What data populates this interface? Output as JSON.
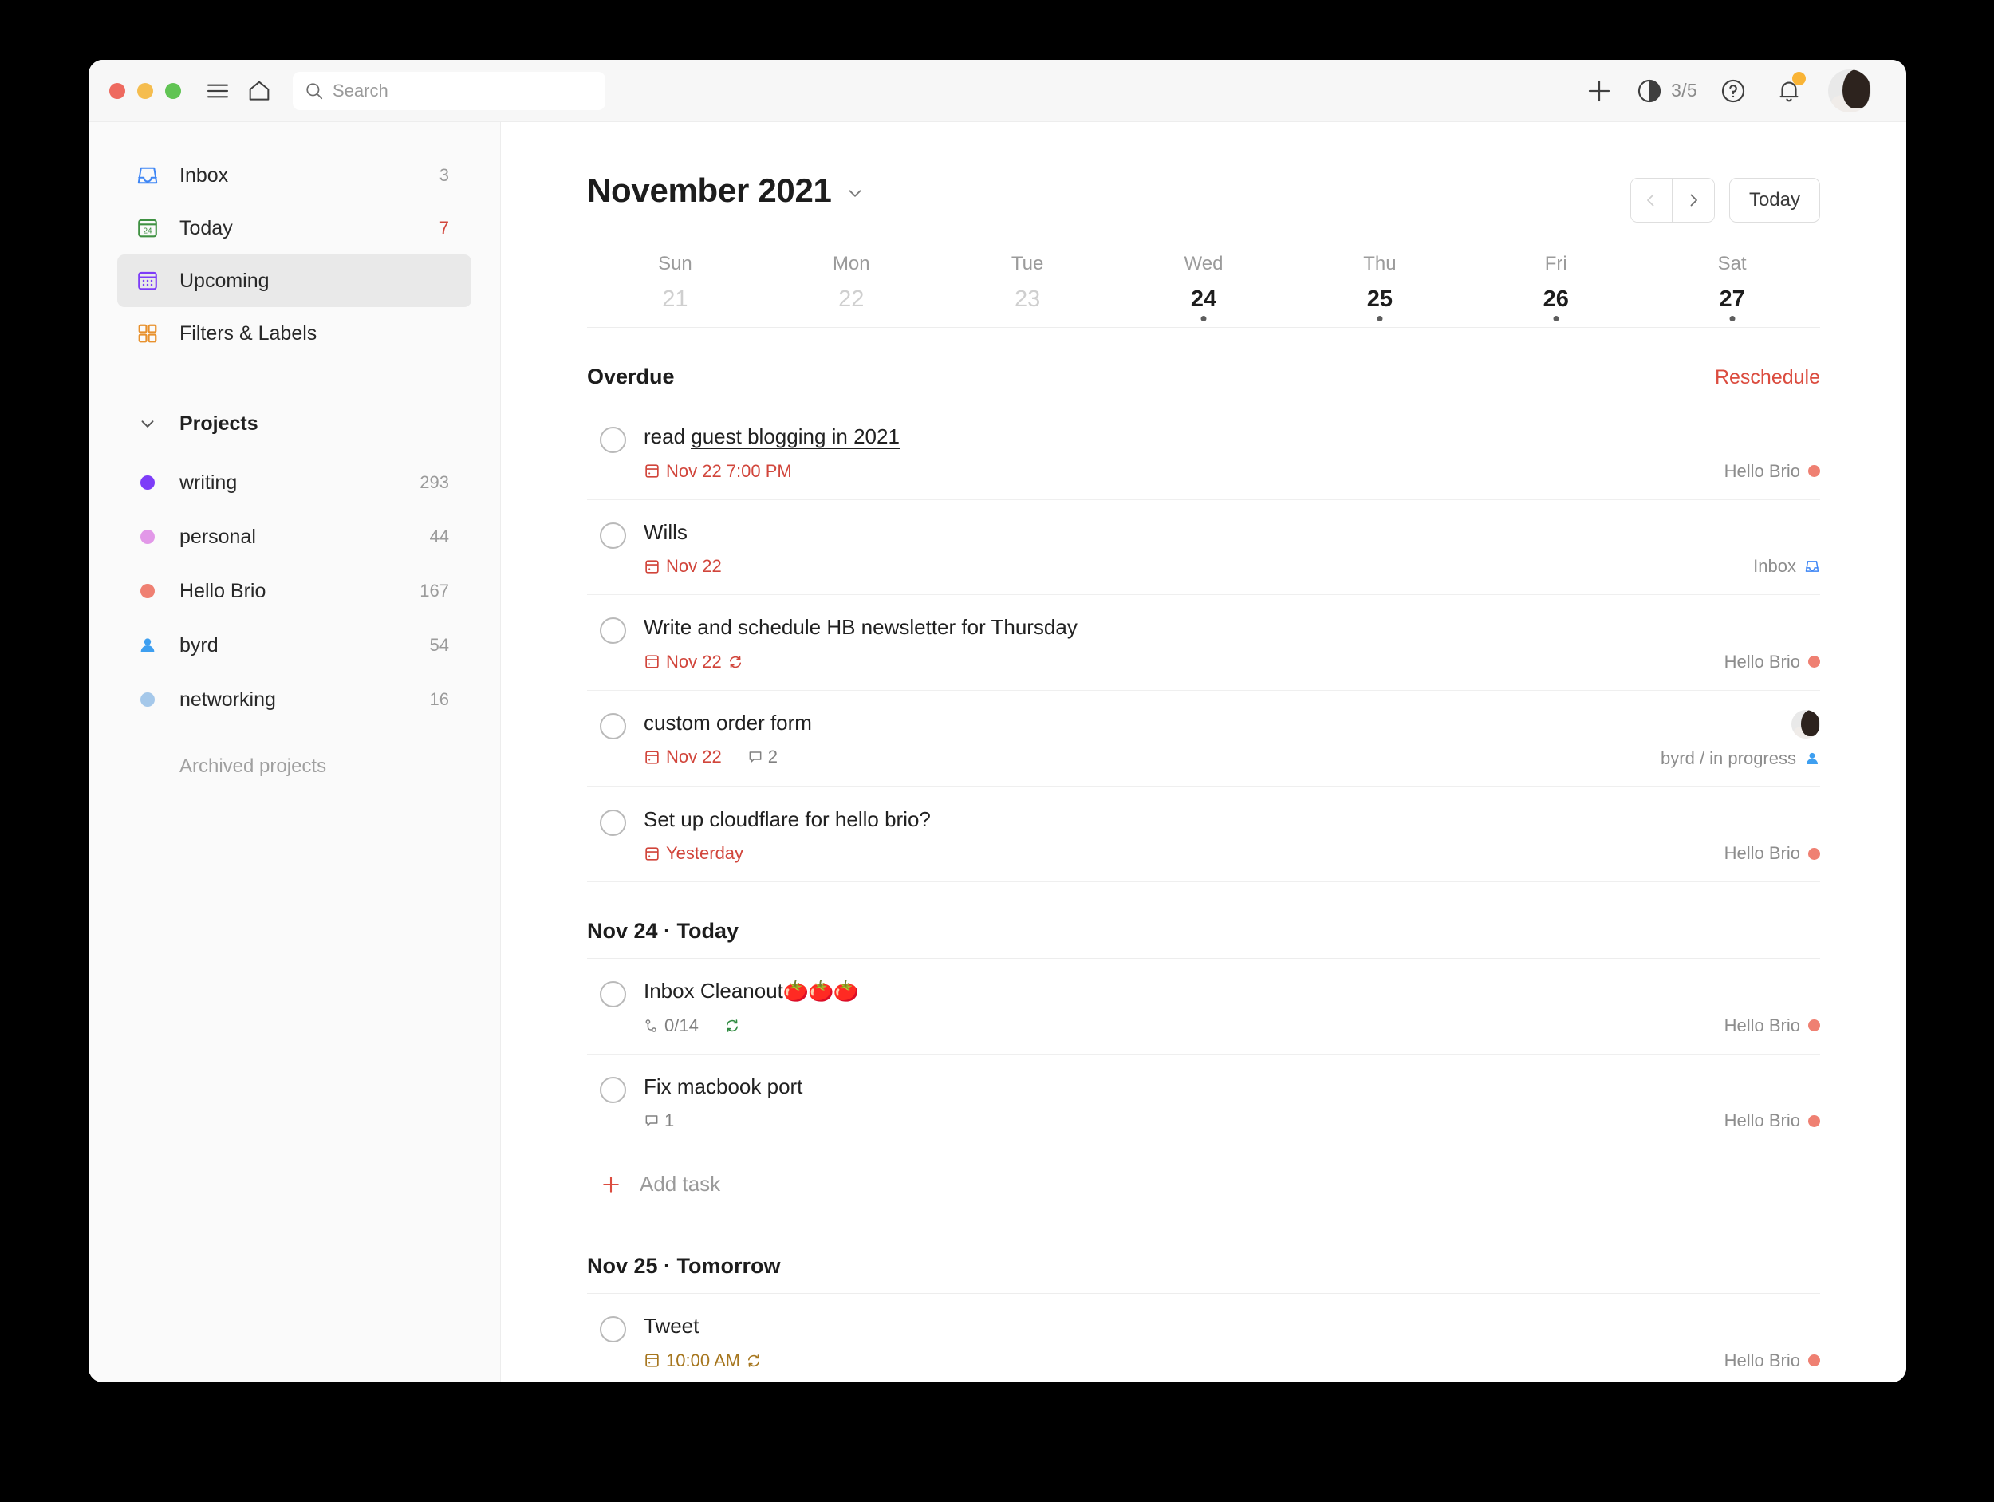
{
  "window": {
    "traffic_lights": [
      "close",
      "minimize",
      "zoom"
    ]
  },
  "titlebar": {
    "menu_icon": "hamburger-icon",
    "home_icon": "home-icon",
    "search": {
      "placeholder": "Search",
      "value": "",
      "icon": "search-icon"
    },
    "add_icon": "plus-icon",
    "productivity_icon": "productivity-circle-icon",
    "productivity_count": "3/5",
    "help_icon": "question-mark-icon",
    "notifications_icon": "bell-icon",
    "notification_badge": true,
    "avatar_icon": "user-avatar"
  },
  "sidebar": {
    "nav": [
      {
        "label": "Inbox",
        "count": "3",
        "icon": "inbox-icon",
        "active": false,
        "accent": false
      },
      {
        "label": "Today",
        "count": "7",
        "icon": "today-calendar-icon",
        "active": false,
        "accent": true
      },
      {
        "label": "Upcoming",
        "count": "",
        "icon": "upcoming-calendar-icon",
        "active": true,
        "accent": false
      },
      {
        "label": "Filters & Labels",
        "count": "",
        "icon": "filters-labels-icon",
        "active": false,
        "accent": false
      }
    ],
    "projects_title": "Projects",
    "projects": [
      {
        "label": "writing",
        "count": "293",
        "color": "#7d3cf8",
        "icon": "dot"
      },
      {
        "label": "personal",
        "count": "44",
        "color": "#e298e8",
        "icon": "dot"
      },
      {
        "label": "Hello Brio",
        "count": "167",
        "color": "#ef8072",
        "icon": "dot"
      },
      {
        "label": "byrd",
        "count": "54",
        "color": "#3e9ff0",
        "icon": "person"
      },
      {
        "label": "networking",
        "count": "16",
        "color": "#a5c8ea",
        "icon": "dot"
      }
    ],
    "archived_label": "Archived projects"
  },
  "main": {
    "month_title": "November 2021",
    "month_chevron_icon": "chevron-down-icon",
    "prev_icon": "chevron-left-icon",
    "next_icon": "chevron-right-icon",
    "today_button": "Today",
    "week": [
      {
        "name": "Sun",
        "num": "21",
        "active": false,
        "dot": false
      },
      {
        "name": "Mon",
        "num": "22",
        "active": false,
        "dot": false
      },
      {
        "name": "Tue",
        "num": "23",
        "active": false,
        "dot": false
      },
      {
        "name": "Wed",
        "num": "24",
        "active": true,
        "dot": true
      },
      {
        "name": "Thu",
        "num": "25",
        "active": true,
        "dot": true
      },
      {
        "name": "Fri",
        "num": "26",
        "active": true,
        "dot": true
      },
      {
        "name": "Sat",
        "num": "27",
        "active": true,
        "dot": true
      }
    ],
    "sections": [
      {
        "title": "Overdue",
        "action": "Reschedule",
        "add_task": null,
        "tasks": [
          {
            "title_pre": "read ",
            "title_link": "guest blogging in 2021",
            "date": "Nov 22 7:00 PM",
            "date_state": "overdue",
            "recurring": false,
            "comments": "",
            "subtasks": "",
            "project": "Hello Brio",
            "project_color": "#ef8072",
            "project_icon": "dot",
            "assignee_avatar": false
          },
          {
            "title_pre": "Wills",
            "title_link": "",
            "date": "Nov 22",
            "date_state": "overdue",
            "recurring": false,
            "comments": "",
            "subtasks": "",
            "project": "Inbox",
            "project_color": "#3e86f5",
            "project_icon": "inbox",
            "assignee_avatar": false
          },
          {
            "title_pre": "Write and schedule HB newsletter for Thursday",
            "title_link": "",
            "date": "Nov 22",
            "date_state": "overdue",
            "recurring": true,
            "comments": "",
            "subtasks": "",
            "project": "Hello Brio",
            "project_color": "#ef8072",
            "project_icon": "dot",
            "assignee_avatar": false
          },
          {
            "title_pre": "custom order form",
            "title_link": "",
            "date": "Nov 22",
            "date_state": "overdue",
            "recurring": false,
            "comments": "2",
            "subtasks": "",
            "project": "byrd / in progress",
            "project_color": "#3e9ff0",
            "project_icon": "person",
            "assignee_avatar": true
          },
          {
            "title_pre": "Set up cloudflare for hello brio?",
            "title_link": "",
            "date": "Yesterday",
            "date_state": "overdue",
            "recurring": false,
            "comments": "",
            "subtasks": "",
            "project": "Hello Brio",
            "project_color": "#ef8072",
            "project_icon": "dot",
            "assignee_avatar": false
          }
        ]
      },
      {
        "title": "Nov 24 · Today",
        "action": "",
        "add_task": "Add task",
        "tasks": [
          {
            "title_pre": "Inbox Cleanout",
            "title_emoji": "🍅🍅🍅",
            "title_link": "",
            "date": "",
            "date_state": "",
            "recurring": true,
            "recurring_green": true,
            "comments": "",
            "subtasks": "0/14",
            "project": "Hello Brio",
            "project_color": "#ef8072",
            "project_icon": "dot",
            "assignee_avatar": false
          },
          {
            "title_pre": "Fix macbook port",
            "title_link": "",
            "date": "",
            "date_state": "",
            "recurring": false,
            "comments": "1",
            "subtasks": "",
            "project": "Hello Brio",
            "project_color": "#ef8072",
            "project_icon": "dot",
            "assignee_avatar": false
          }
        ]
      },
      {
        "title": "Nov 25 · Tomorrow",
        "action": "",
        "add_task": null,
        "tasks": [
          {
            "title_pre": "Tweet",
            "title_link": "",
            "date": "10:00 AM",
            "date_state": "upcoming",
            "recurring": true,
            "comments": "",
            "subtasks": "",
            "project": "Hello Brio",
            "project_color": "#ef8072",
            "project_icon": "dot",
            "assignee_avatar": false
          }
        ]
      }
    ]
  },
  "colors": {
    "accent_red": "#db4c3f",
    "overdue_red": "#d1453b",
    "upcoming_amber": "#a6761e",
    "sidebar_bg": "#fafafa",
    "active_bg": "#e9e9e9"
  }
}
